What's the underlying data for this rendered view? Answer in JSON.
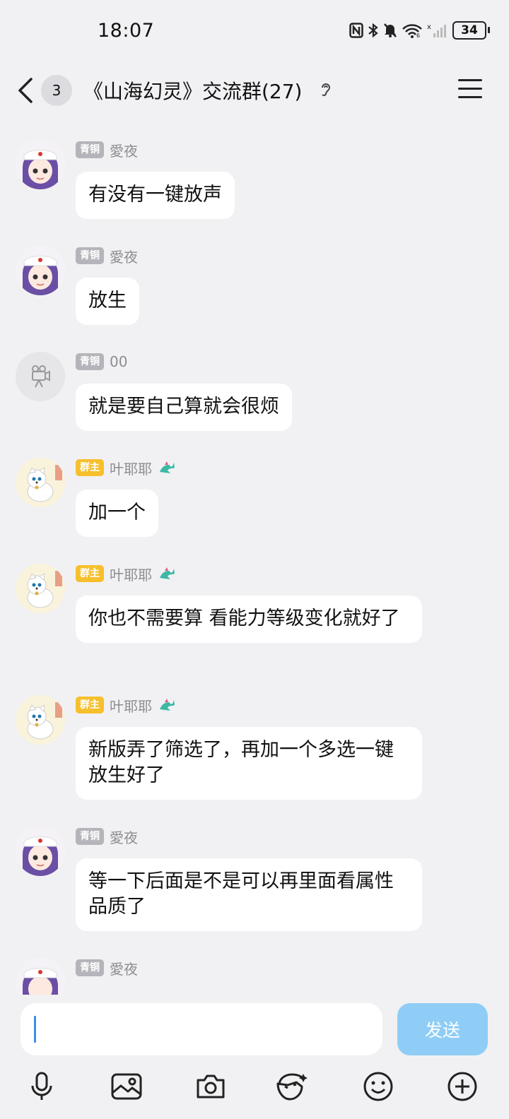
{
  "status_bar": {
    "time": "18:07",
    "battery": "34"
  },
  "header": {
    "unread_count": "3",
    "title": "《山海幻灵》交流群(27)"
  },
  "messages": [
    {
      "tag": "青铜",
      "tag_color": "#b4b4ba",
      "nick": "愛夜",
      "avatar": "girl-avatar",
      "text": "有没有一键放声"
    },
    {
      "tag": "青铜",
      "tag_color": "#b4b4ba",
      "nick": "愛夜",
      "avatar": "girl-avatar",
      "text": "放生"
    },
    {
      "tag": "青铜",
      "tag_color": "#b4b4ba",
      "nick": "00",
      "avatar": "camera-avatar",
      "text": "就是要自己算就会很烦"
    },
    {
      "tag": "群主",
      "tag_color": "#f6bf2c",
      "nick": "叶耶耶",
      "avatar": "dog-avatar",
      "text": "加一个"
    },
    {
      "tag": "群主",
      "tag_color": "#f6bf2c",
      "nick": "叶耶耶",
      "avatar": "dog-avatar",
      "text": "你也不需要算 看能力等级变化就好了"
    },
    {
      "tag": "群主",
      "tag_color": "#f6bf2c",
      "nick": "叶耶耶",
      "avatar": "dog-avatar",
      "text": "新版弄了筛选了，再加一个多选一键放生好了"
    },
    {
      "tag": "青铜",
      "tag_color": "#b4b4ba",
      "nick": "愛夜",
      "avatar": "girl-avatar",
      "text": "等一下后面是不是可以再里面看属性品质了"
    },
    {
      "tag": "青铜",
      "tag_color": "#b4b4ba",
      "nick": "愛夜",
      "avatar": "girl-avatar",
      "text": ""
    }
  ],
  "input": {
    "value": "",
    "send_label": "发送"
  },
  "toolbar": [
    "mic-icon",
    "image-icon",
    "camera-icon",
    "emoji-face-icon",
    "smile-icon",
    "plus-icon"
  ]
}
